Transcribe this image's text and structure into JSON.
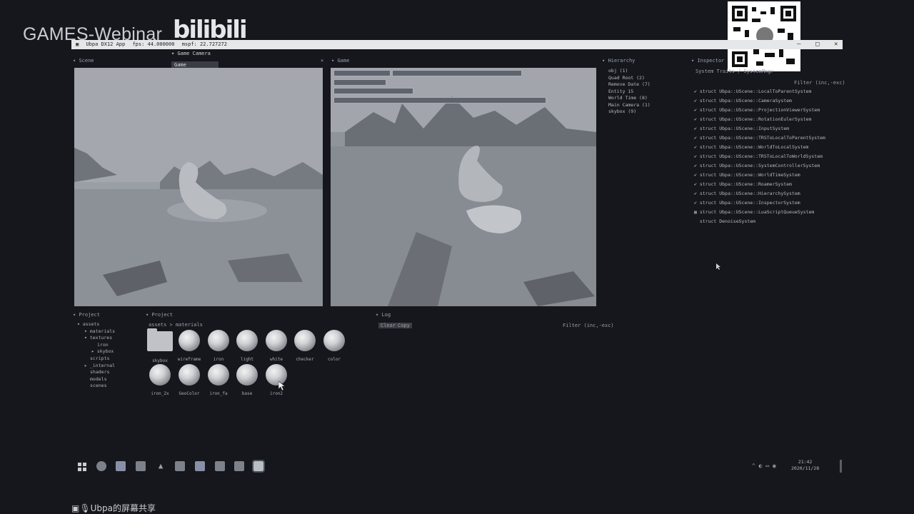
{
  "brand": {
    "name": "GAMES-Webinar",
    "logo_text": "bilibili"
  },
  "window": {
    "title": "Ubpa DX12 App",
    "fps": "fps: 44.000000",
    "mspf": "mspf: 22.727272"
  },
  "menu_tip": {
    "item": "Game Camera",
    "box": "Game"
  },
  "panels": {
    "scene": "Scene",
    "game": "Game",
    "hierarchy": "Hierarchy",
    "inspector": "Inspector",
    "project_tree": "Project",
    "project_files": "Project",
    "log": "Log"
  },
  "hierarchy": {
    "items": [
      "obj (1)",
      "Quad Root (2)",
      "Remove Date (7)",
      "Entity 15",
      "World Time (8)",
      "Main Camera (1)",
      "skybox (9)"
    ]
  },
  "inspector": {
    "header": "System Traits / SystemMngr",
    "filter": "Filter (inc,-exc)",
    "systems": [
      {
        "checked": true,
        "text": "struct Ubpa::UScene::LocalToParentSystem"
      },
      {
        "checked": true,
        "text": "struct Ubpa::UScene::CameraSystem"
      },
      {
        "checked": true,
        "text": "struct Ubpa::UScene::ProjectionViewerSystem"
      },
      {
        "checked": true,
        "text": "struct Ubpa::UScene::RotationEulerSystem"
      },
      {
        "checked": true,
        "text": "struct Ubpa::UScene::InputSystem"
      },
      {
        "checked": true,
        "text": "struct Ubpa::UScene::TRSToLocalToParentSystem"
      },
      {
        "checked": true,
        "text": "struct Ubpa::UScene::WorldToLocalSystem"
      },
      {
        "checked": true,
        "text": "struct Ubpa::UScene::TRSToLocalToWorldSystem"
      },
      {
        "checked": true,
        "text": "struct Ubpa::UScene::SystemControllerSystem"
      },
      {
        "checked": true,
        "text": "struct Ubpa::UScene::WorldTimeSystem"
      },
      {
        "checked": true,
        "text": "struct Ubpa::UScene::RoamerSystem"
      },
      {
        "checked": true,
        "text": "struct Ubpa::UScene::HierarchySystem"
      },
      {
        "checked": true,
        "text": "struct Ubpa::UScene::InspectorSystem"
      },
      {
        "checked": false,
        "text": "struct Ubpa::UScene::LuaScriptQueueSystem"
      },
      {
        "checked": false,
        "text": "struct DenoiseSystem"
      }
    ]
  },
  "project_tree": {
    "items": [
      "assets",
      "materials",
      "textures",
      "iron",
      "skybox",
      "scripts",
      "_internal",
      "shaders",
      "models",
      "scenes"
    ]
  },
  "project_files": {
    "path_root": "assets",
    "path_sep": ">",
    "path_current": "materials",
    "assets": [
      {
        "name": "skybox",
        "kind": "folder"
      },
      {
        "name": "wireframe",
        "kind": "material"
      },
      {
        "name": "iron",
        "kind": "material"
      },
      {
        "name": "light",
        "kind": "material"
      },
      {
        "name": "white",
        "kind": "material"
      },
      {
        "name": "checker",
        "kind": "material"
      },
      {
        "name": "color",
        "kind": "material"
      },
      {
        "name": "iron_2x",
        "kind": "material"
      },
      {
        "name": "GeoColor",
        "kind": "material"
      },
      {
        "name": "iron_fa",
        "kind": "material"
      },
      {
        "name": "base",
        "kind": "material"
      },
      {
        "name": "iron2",
        "kind": "material"
      }
    ]
  },
  "log": {
    "clear": "Clear",
    "copy": "Copy",
    "filter": "Filter (inc,-exc)"
  },
  "tray": {
    "time": "21:42",
    "date": "2020/11/28"
  },
  "share_label": "Ubpa的屏幕共享",
  "colors": {
    "background": "#15171c",
    "viewport": "#8f949c",
    "titlebar": "#e6e7e9"
  }
}
